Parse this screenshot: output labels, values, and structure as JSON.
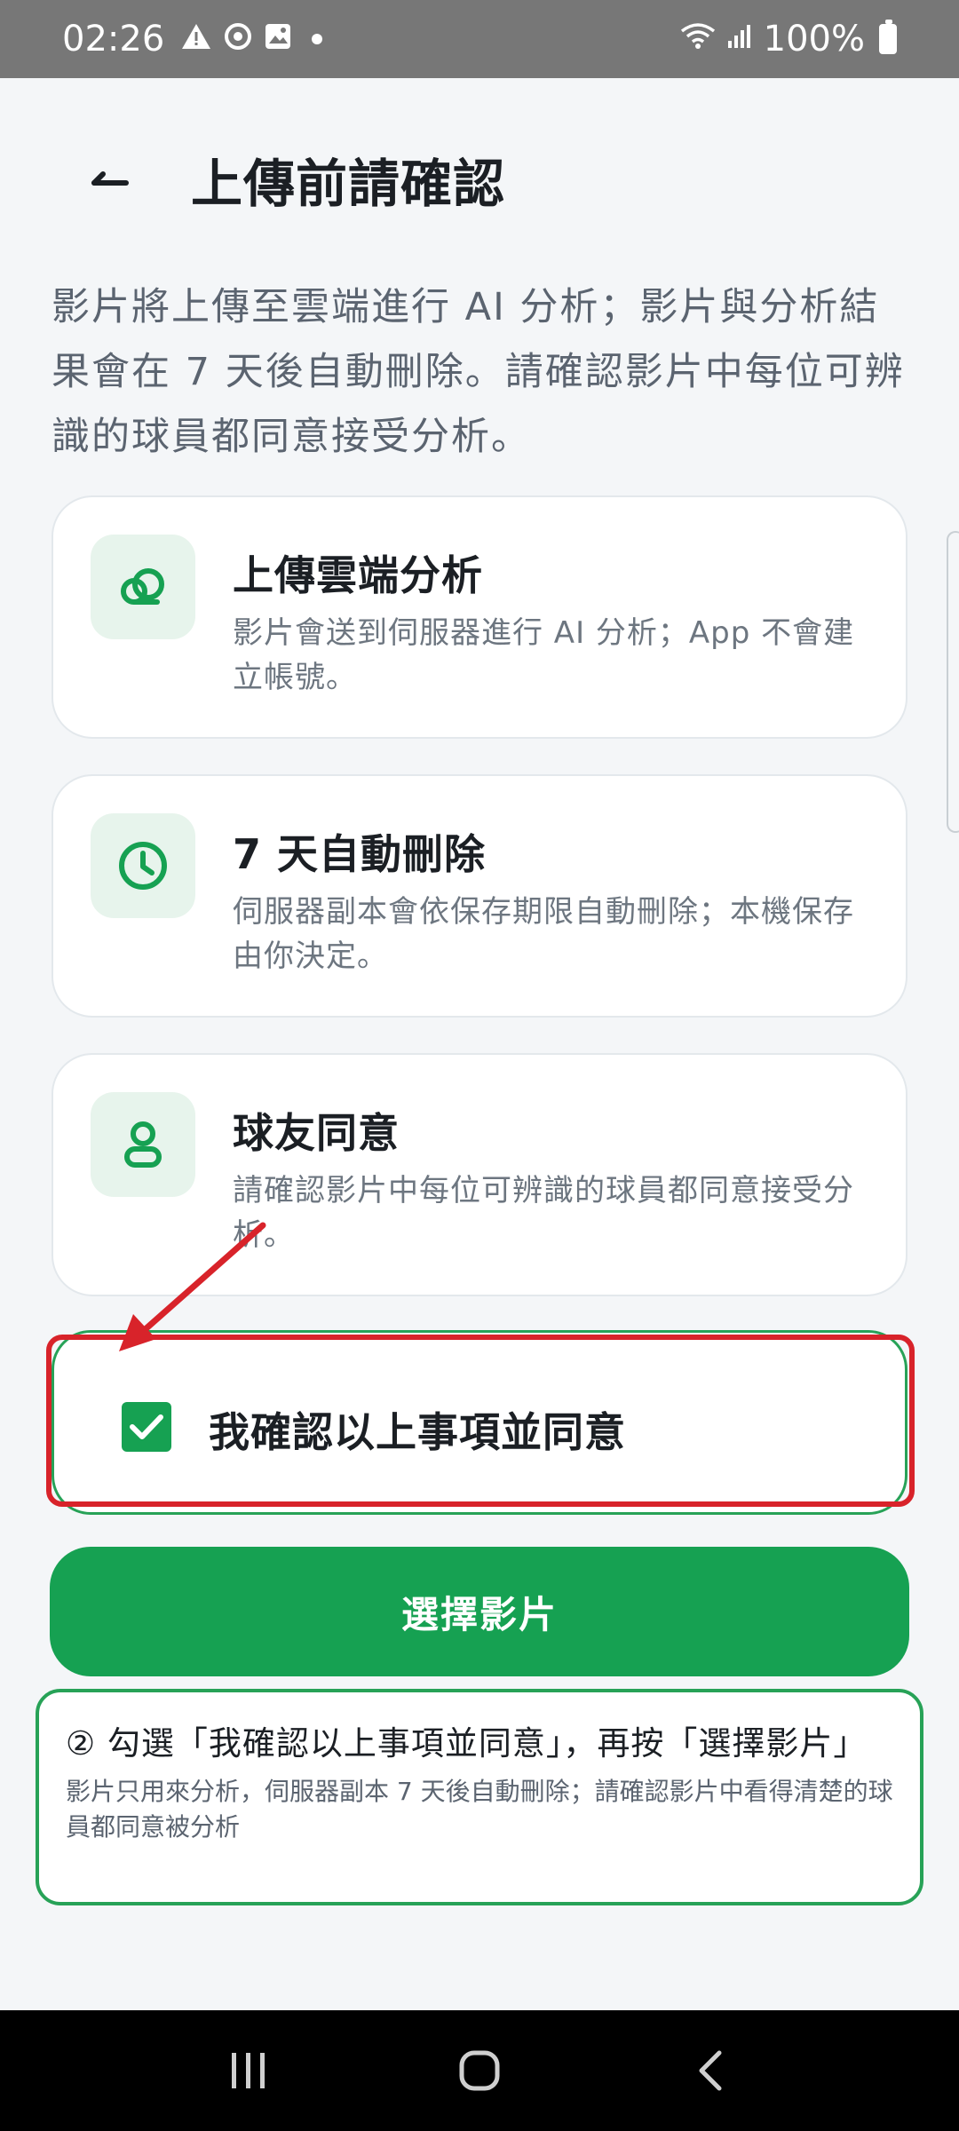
{
  "status_bar": {
    "time": "02:26",
    "battery": "100%",
    "icons": [
      "warning-icon",
      "sync-icon",
      "image-icon",
      "dot-icon",
      "wifi-icon",
      "signal-icon",
      "battery-icon"
    ]
  },
  "header": {
    "title": "上傳前請確認"
  },
  "intro": "影片將上傳至雲端進行 AI 分析；影片與分析結果會在 7 天後自動刪除。請確認影片中每位可辨識的球員都同意接受分析。",
  "cards": [
    {
      "icon": "cloud-icon",
      "title": "上傳雲端分析",
      "desc": "影片會送到伺服器進行 AI 分析；App 不會建立帳號。"
    },
    {
      "icon": "clock-icon",
      "title": "7 天自動刪除",
      "desc": "伺服器副本會依保存期限自動刪除；本機保存由你決定。"
    },
    {
      "icon": "person-icon",
      "title": "球友同意",
      "desc": "請確認影片中每位可辨識的球員都同意接受分析。"
    }
  ],
  "consent": {
    "label": "我確認以上事項並同意",
    "checked": true
  },
  "primary_button": "選擇影片",
  "note": {
    "main": "② 勾選「我確認以上事項並同意」，再按「選擇影片」",
    "sub": "影片只用來分析，伺服器副本 7 天後自動刪除；請確認影片中看得清楚的球員都同意被分析"
  },
  "colors": {
    "accent": "#16a152",
    "highlight_red": "#d8232a",
    "icon_bg": "#e7f4ec",
    "status_bar": "#777777"
  }
}
